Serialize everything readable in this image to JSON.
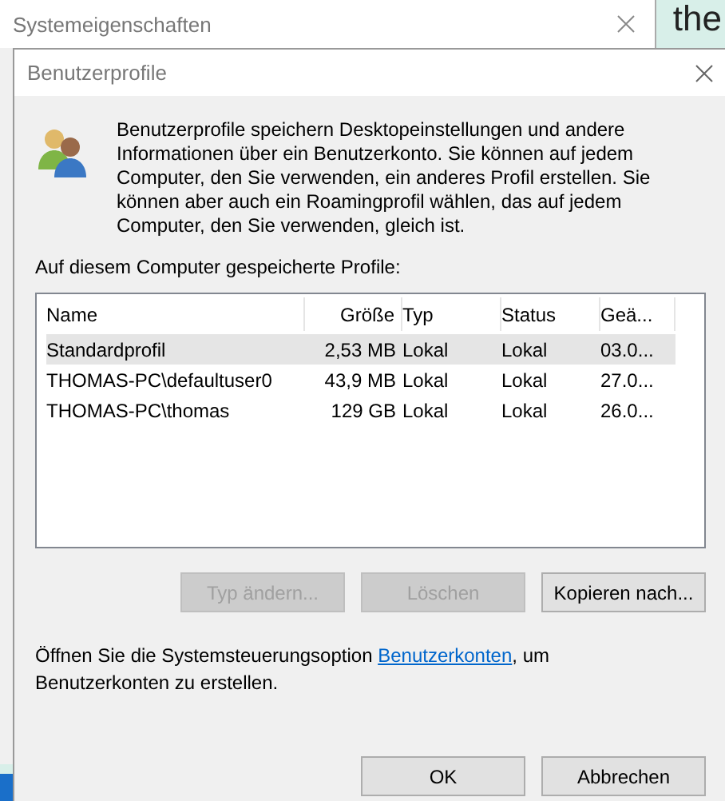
{
  "background_window": {
    "title": "Systemeigenschaften"
  },
  "background_text": "the",
  "dialog": {
    "title": "Benutzerprofile",
    "description": "Benutzerprofile speichern Desktopeinstellungen und andere Informationen über ein Benutzerkonto. Sie können auf jedem Computer, den Sie verwenden, ein anderes Profil erstellen. Sie können aber auch ein Roamingprofil wählen, das auf jedem Computer, den Sie verwenden, gleich ist.",
    "list_label": "Auf diesem Computer gespeicherte Profile:",
    "table": {
      "columns": [
        "Name",
        "Größe",
        "Typ",
        "Status",
        "Geä..."
      ],
      "rows": [
        {
          "cells": [
            "Standardprofil",
            "2,53 MB",
            "Lokal",
            "Lokal",
            "03.0..."
          ],
          "selected": true
        },
        {
          "cells": [
            "THOMAS-PC\\defaultuser0",
            "43,9 MB",
            "Lokal",
            "Lokal",
            "27.0..."
          ],
          "selected": false
        },
        {
          "cells": [
            "THOMAS-PC\\thomas",
            "129 GB",
            "Lokal",
            "Lokal",
            "26.0..."
          ],
          "selected": false
        }
      ]
    },
    "profile_buttons": [
      {
        "label": "Typ ändern...",
        "disabled": true
      },
      {
        "label": "Löschen",
        "disabled": true
      },
      {
        "label": "Kopieren nach...",
        "disabled": false
      }
    ],
    "footer_before": "Öffnen Sie die Systemsteuerungsoption",
    "footer_link": "Benutzerkonten",
    "footer_after": ", um Benutzerkonten zu erstellen.",
    "buttons": [
      {
        "label": "OK",
        "disabled": false
      },
      {
        "label": "Abbrechen",
        "disabled": false
      }
    ]
  }
}
